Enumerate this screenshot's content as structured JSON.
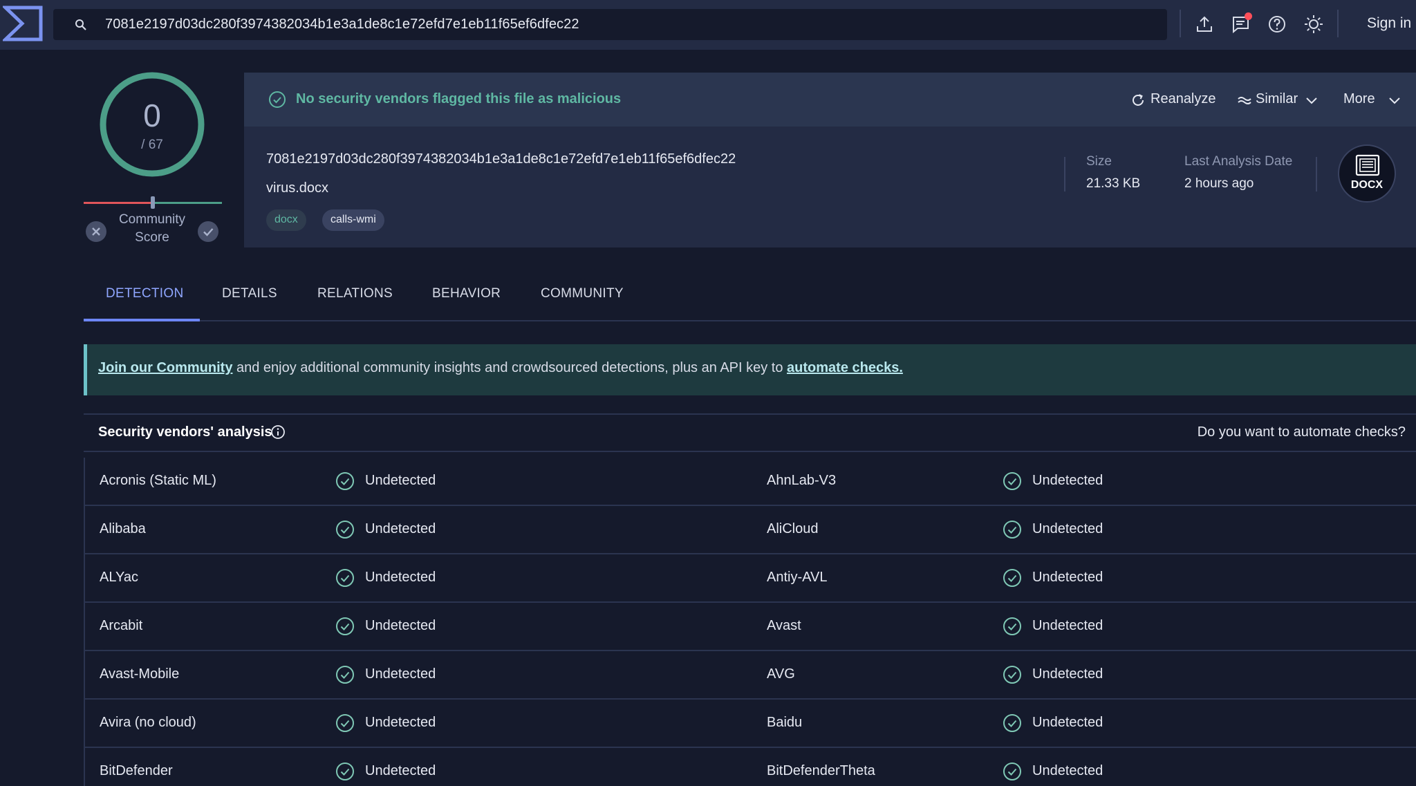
{
  "search": {
    "query": "7081e2197d03dc280f3974382034b1e3a1de8c1e72efd7e1eb11f65ef6dfec22"
  },
  "topbar": {
    "sign_in": "Sign in",
    "accent": "#8fa6ff",
    "notification_color": "#ff4f5a"
  },
  "score": {
    "detections": "0",
    "total": "/ 67",
    "community_label": "Community Score",
    "ring_color": "#4c9e88"
  },
  "summary": {
    "status_text": "No security vendors flagged this file as malicious",
    "actions": {
      "reanalyze": "Reanalyze",
      "similar": "Similar",
      "more": "More"
    },
    "hash": "7081e2197d03dc280f3974382034b1e3a1de8c1e72efd7e1eb11f65ef6dfec22",
    "filename": "virus.docx",
    "tags": [
      "docx",
      "calls-wmi"
    ],
    "size_label": "Size",
    "size_value": "21.33 KB",
    "date_label": "Last Analysis Date",
    "date_value": "2 hours ago",
    "file_type_badge": "DOCX"
  },
  "tabs": [
    "DETECTION",
    "DETAILS",
    "RELATIONS",
    "BEHAVIOR",
    "COMMUNITY"
  ],
  "banner": {
    "link1": "Join our Community",
    "middle": " and enjoy additional community insights and crowdsourced detections, plus an API key to ",
    "link2": "automate checks."
  },
  "vendors": {
    "title": "Security vendors' analysis",
    "automate_question": "Do you want to automate checks?",
    "rows": [
      [
        {
          "name": "Acronis (Static ML)",
          "status": "Undetected"
        },
        {
          "name": "AhnLab-V3",
          "status": "Undetected"
        }
      ],
      [
        {
          "name": "Alibaba",
          "status": "Undetected"
        },
        {
          "name": "AliCloud",
          "status": "Undetected"
        }
      ],
      [
        {
          "name": "ALYac",
          "status": "Undetected"
        },
        {
          "name": "Antiy-AVL",
          "status": "Undetected"
        }
      ],
      [
        {
          "name": "Arcabit",
          "status": "Undetected"
        },
        {
          "name": "Avast",
          "status": "Undetected"
        }
      ],
      [
        {
          "name": "Avast-Mobile",
          "status": "Undetected"
        },
        {
          "name": "AVG",
          "status": "Undetected"
        }
      ],
      [
        {
          "name": "Avira (no cloud)",
          "status": "Undetected"
        },
        {
          "name": "Baidu",
          "status": "Undetected"
        }
      ],
      [
        {
          "name": "BitDefender",
          "status": "Undetected"
        },
        {
          "name": "BitDefenderTheta",
          "status": "Undetected"
        }
      ]
    ]
  }
}
